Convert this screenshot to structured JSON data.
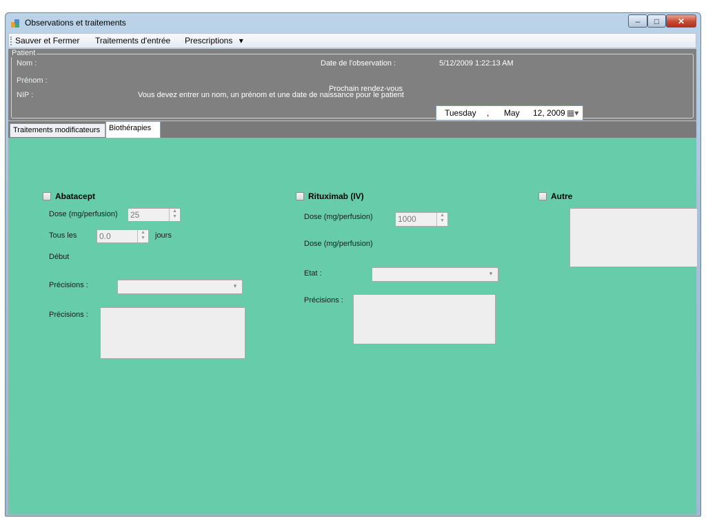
{
  "window": {
    "title": "Observations et traitements",
    "minimize_glyph": "–",
    "maximize_glyph": "□",
    "close_glyph": "✕"
  },
  "menu": {
    "save_close": "Sauver et Fermer",
    "entry_treatments": "Traitements d'entrée",
    "prescriptions": "Prescriptions",
    "prescriptions_arrow": "▾"
  },
  "patient": {
    "group_label": "Patient",
    "nom_label": "Nom :",
    "prenom_label": "Prénom :",
    "nip_label": "NIP :",
    "warning": "Vous devez entrer un nom, un prénom et une date de naissance pour le patient",
    "obs_date_label": "Date de l'observation :",
    "obs_date_value": "5/12/2009 1:22:13 AM",
    "next_rdv_label": "Prochain rendez-vous",
    "next_rdv_day": "Tuesday",
    "next_rdv_sep": ",",
    "next_rdv_month": "May",
    "next_rdv_date": "12, 2009",
    "calendar_icon_glyph": "▦▾"
  },
  "tabs": [
    {
      "label": "Traitements modificateurs",
      "active": false
    },
    {
      "label": "Biothérapies",
      "active": true
    }
  ],
  "abatacept": {
    "title": "Abatacept",
    "dose_label": "Dose (mg/perfusion)",
    "dose_value": "25",
    "every_label": "Tous les",
    "every_value": "0.0",
    "every_unit": "jours",
    "start_label": "Début",
    "precisions_combo_label": "Précisions :",
    "precisions_text_label": "Précisions :"
  },
  "rituximab": {
    "title": "Rituximab (IV)",
    "dose_label": "Dose (mg/perfusion)",
    "dose_value": "1000",
    "dose2_label": "Dose (mg/perfusion)",
    "state_label": "Etat :",
    "precisions_label": "Précisions :"
  },
  "autre": {
    "title": "Autre"
  },
  "spin_glyph_up": "▲",
  "spin_glyph_down": "▼",
  "combo_glyph": "▾",
  "colors": {
    "page_bg": "#66ccaa",
    "patient_bg": "#808080",
    "titlebar": "#a8c1da"
  }
}
